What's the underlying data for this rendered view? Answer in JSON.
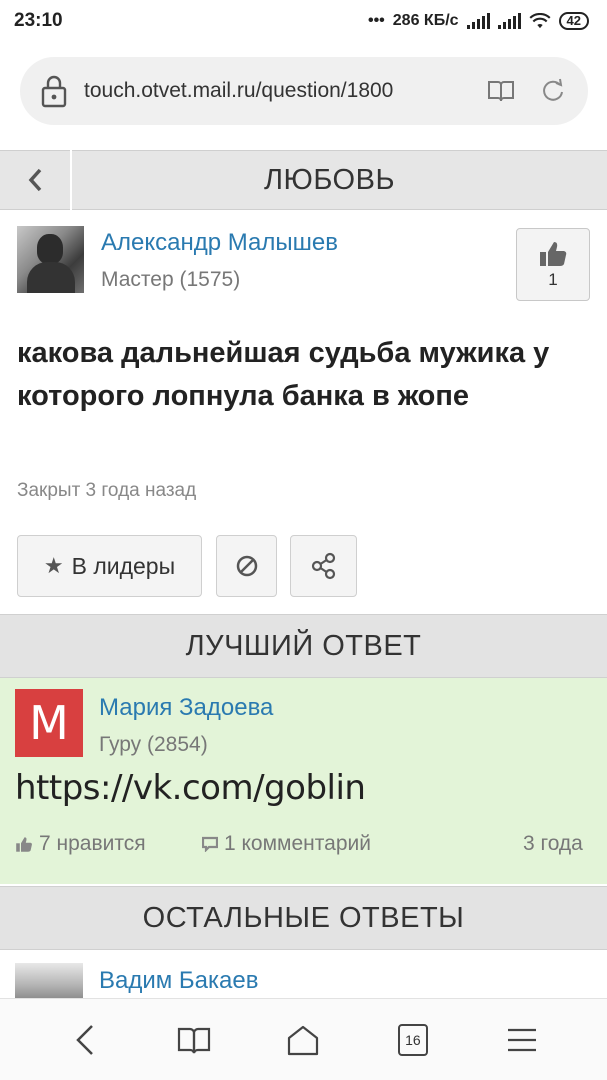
{
  "status_bar": {
    "time": "23:10",
    "dots": "•••",
    "speed": "286 КБ/с",
    "battery": "42"
  },
  "browser": {
    "url": "touch.otvet.mail.ru/question/1800",
    "icons": [
      "lock-icon",
      "reader-mode-icon",
      "reload-icon"
    ]
  },
  "category": {
    "title": "ЛЮБОВЬ",
    "back_icon": "chevron-left-icon"
  },
  "question": {
    "author_name": "Александр Малышев",
    "author_rank": "Мастер (1575)",
    "like_count": "1",
    "text": "какова дальнейшая судьба мужика у которого лопнула банка в жопе",
    "closed": "Закрыт 3 года назад"
  },
  "actions": {
    "leaders_label": "В лидеры",
    "icons": [
      "star-icon",
      "block-icon",
      "share-icon"
    ]
  },
  "best_answer": {
    "section_title": "ЛУЧШИЙ ОТВЕТ",
    "avatar_letter": "M",
    "author_name": "Мария Задоева",
    "author_rank": "Гуру (2854)",
    "text": "https://vk.com/goblin",
    "likes": "7 нравится",
    "comments": "1 комментарий",
    "age": "3 года",
    "accent_bg": "#e3f4d8"
  },
  "other_answers": {
    "section_title": "ОСТАЛЬНЫЕ ОТВЕТЫ",
    "first_author": "Вадим Бакаев"
  },
  "bottom_nav": {
    "tabs_count": "16",
    "icons": [
      "back-icon",
      "bookmarks-icon",
      "home-icon",
      "tabs-icon",
      "menu-icon"
    ]
  },
  "colors": {
    "link": "#2a7ab0",
    "header_bg": "#e6e6e6"
  }
}
